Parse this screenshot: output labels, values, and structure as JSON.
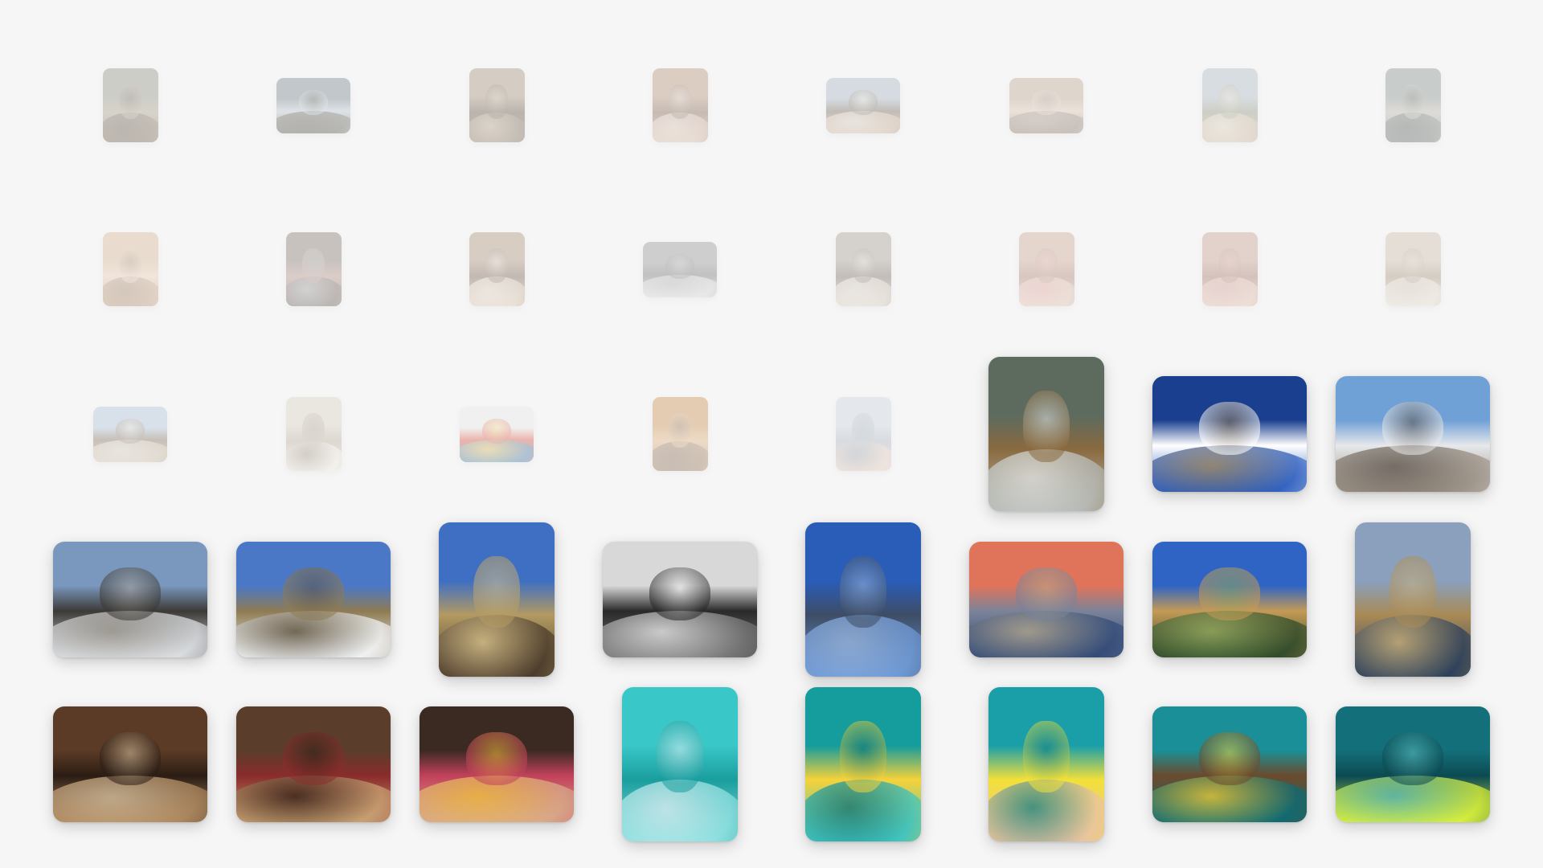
{
  "app": {
    "background": "#f6f6f6"
  },
  "rows": [
    {
      "name": "row-1",
      "faded": true,
      "items": [
        {
          "id": "chicken-coop",
          "orientation": "portrait",
          "palette": [
            "#8c8b7e",
            "#6b5a45",
            "#a79c86",
            "#4f4437"
          ]
        },
        {
          "id": "man-under-tree",
          "orientation": "landscape",
          "palette": [
            "#6e7d86",
            "#4d4a3f",
            "#b7c5d0",
            "#3b3529"
          ]
        },
        {
          "id": "dog-doorway",
          "orientation": "portrait",
          "palette": [
            "#a08c74",
            "#7a6650",
            "#5a4b3c",
            "#c9b59a"
          ]
        },
        {
          "id": "hands-eggs",
          "orientation": "portrait",
          "palette": [
            "#b08b70",
            "#d0b09a",
            "#7a5c49",
            "#e6d2c2"
          ]
        },
        {
          "id": "girls-on-fence",
          "orientation": "landscape",
          "palette": [
            "#a0b0bd",
            "#c7a98c",
            "#6f6054",
            "#e6e0d8"
          ]
        },
        {
          "id": "two-girls-selfie",
          "orientation": "landscape",
          "palette": [
            "#b9a18a",
            "#7d6a5d",
            "#d9c3ad",
            "#9a8776"
          ]
        },
        {
          "id": "girl-scarf",
          "orientation": "portrait",
          "palette": [
            "#a8b7c2",
            "#c9b195",
            "#8b8f77",
            "#e9dccb"
          ]
        },
        {
          "id": "eggs-in-hand",
          "orientation": "portrait",
          "palette": [
            "#7f8a86",
            "#5d6560",
            "#b8b2a8",
            "#3f4643"
          ]
        }
      ]
    },
    {
      "name": "row-2",
      "faded": true,
      "items": [
        {
          "id": "girl-wicker-chair",
          "orientation": "portrait",
          "palette": [
            "#d5b48f",
            "#b88e6a",
            "#e9c9b3",
            "#8a6a4f"
          ]
        },
        {
          "id": "girl-on-floor",
          "orientation": "portrait",
          "palette": [
            "#7f6f66",
            "#5b4c45",
            "#b08d80",
            "#9aa4a8"
          ]
        },
        {
          "id": "woman-with-cat",
          "orientation": "portrait",
          "palette": [
            "#a98c72",
            "#d6c1a8",
            "#6e5846",
            "#f0e2d2"
          ]
        },
        {
          "id": "two-women-doorway",
          "orientation": "landscape",
          "palette": [
            "#8f8f8f",
            "#d6d6d6",
            "#6b6b6b",
            "#b6b6b6"
          ]
        },
        {
          "id": "girl-holding-cat",
          "orientation": "portrait",
          "palette": [
            "#a1978c",
            "#d6c8b8",
            "#6f6259",
            "#e8ddd1"
          ]
        },
        {
          "id": "girl-pink-sweater",
          "orientation": "portrait",
          "palette": [
            "#c9a28b",
            "#e0c0aa",
            "#a87c6b",
            "#e8a2a0"
          ]
        },
        {
          "id": "girl-hand-hair",
          "orientation": "portrait",
          "palette": [
            "#c49a86",
            "#e2bba8",
            "#a16e60",
            "#d89d98"
          ]
        },
        {
          "id": "girl-with-puppy",
          "orientation": "portrait",
          "palette": [
            "#c8b9a4",
            "#e6dccd",
            "#a28d72",
            "#d3c9bb"
          ]
        }
      ]
    },
    {
      "name": "row-3",
      "faded": false,
      "items": [
        {
          "id": "cowboy-on-horse",
          "orientation": "landscape",
          "faded": true,
          "palette": [
            "#a9c0d6",
            "#c9b79f",
            "#7d6a55",
            "#e3dcd2"
          ]
        },
        {
          "id": "girl-with-white-horse",
          "orientation": "portrait",
          "faded": true,
          "palette": [
            "#d9cfbf",
            "#f2ede4",
            "#b5a893",
            "#8c7e6a"
          ]
        },
        {
          "id": "archery-target",
          "orientation": "landscape",
          "faded": true,
          "palette": [
            "#e7e7e7",
            "#2f6fa1",
            "#d94b3a",
            "#f2d24a"
          ]
        },
        {
          "id": "girl-orange-sweater",
          "orientation": "portrait",
          "faded": true,
          "palette": [
            "#c98a45",
            "#8e6a4c",
            "#e1b07a",
            "#6e5646"
          ]
        },
        {
          "id": "sunset-sea",
          "orientation": "portrait",
          "faded": true,
          "palette": [
            "#c8d4de",
            "#e7c9b9",
            "#a7b2bd",
            "#8c98a3"
          ]
        },
        {
          "id": "frost-grass-rock",
          "orientation": "portrait-lg",
          "palette": [
            "#5d6b5f",
            "#b6bab6",
            "#8a6a3f",
            "#e3e6e6"
          ]
        },
        {
          "id": "snowy-peak-blue-sky",
          "orientation": "landscape",
          "palette": [
            "#1a3f8f",
            "#2e5fbf",
            "#ffffff",
            "#8a744f"
          ]
        },
        {
          "id": "snowy-boulders",
          "orientation": "landscape",
          "palette": [
            "#6fa0d6",
            "#9c9286",
            "#e6e8ea",
            "#5a5149"
          ]
        }
      ]
    },
    {
      "name": "row-4",
      "faded": false,
      "items": [
        {
          "id": "snow-rocks-ridge",
          "orientation": "landscape",
          "palette": [
            "#7a97bd",
            "#dcdfe3",
            "#3c3a36",
            "#a7a29a"
          ]
        },
        {
          "id": "mountain-meadow",
          "orientation": "landscape",
          "palette": [
            "#4a78c7",
            "#f1f3f5",
            "#8e7b53",
            "#5c5140"
          ]
        },
        {
          "id": "pine-trunks",
          "orientation": "portrait-lg",
          "palette": [
            "#3e6fc2",
            "#4a3a2a",
            "#b39a62",
            "#d9c48f"
          ]
        },
        {
          "id": "bw-mountain",
          "orientation": "landscape",
          "palette": [
            "#d8d8d8",
            "#777777",
            "#2a2a2a",
            "#f3f3f3"
          ]
        },
        {
          "id": "horse-in-water",
          "orientation": "portrait-lg",
          "palette": [
            "#2a5db8",
            "#6f9ad6",
            "#3d4d66",
            "#9bb7de"
          ]
        },
        {
          "id": "sunset-forest",
          "orientation": "landscape",
          "palette": [
            "#e0745a",
            "#334b78",
            "#7a8399",
            "#b6a98c"
          ]
        },
        {
          "id": "pine-valley",
          "orientation": "landscape",
          "palette": [
            "#2f64c4",
            "#2f4a2a",
            "#c49a55",
            "#8aa85f"
          ]
        },
        {
          "id": "grassland-horizon",
          "orientation": "portrait-lg",
          "palette": [
            "#8aa0bd",
            "#2b3f5a",
            "#a98a55",
            "#c9b27e"
          ]
        }
      ]
    },
    {
      "name": "row-5",
      "faded": false,
      "items": [
        {
          "id": "pug-on-deck",
          "orientation": "landscape",
          "palette": [
            "#5b3b25",
            "#b08a60",
            "#2b1d14",
            "#d8c3a3"
          ]
        },
        {
          "id": "pug-sleeping",
          "orientation": "landscape",
          "palette": [
            "#5a3d2b",
            "#c9a173",
            "#8a2c2c",
            "#2d1e14"
          ]
        },
        {
          "id": "mother-daughter",
          "orientation": "landscape",
          "palette": [
            "#3b2a22",
            "#d9a98a",
            "#c2425b",
            "#f0c23a"
          ]
        },
        {
          "id": "girl-in-pool-swimsuit",
          "orientation": "portrait-lg",
          "palette": [
            "#39c7c7",
            "#8fe0e0",
            "#1a9e9e",
            "#e1eef2"
          ]
        },
        {
          "id": "girls-underwater",
          "orientation": "portrait-lg",
          "palette": [
            "#159c9c",
            "#3fc3c0",
            "#f5d23a",
            "#0f6f6f"
          ]
        },
        {
          "id": "girl-smiling-pool",
          "orientation": "portrait-lg",
          "palette": [
            "#1a9fa8",
            "#e9c49f",
            "#f2e03a",
            "#0f7c85"
          ]
        },
        {
          "id": "hair-underwater",
          "orientation": "landscape",
          "palette": [
            "#1a8f97",
            "#0e6a72",
            "#6b4a2d",
            "#f0d23a"
          ]
        },
        {
          "id": "yellow-shirt-water",
          "orientation": "landscape",
          "palette": [
            "#136f7a",
            "#d9ef3a",
            "#0c4a52",
            "#5fbfbd"
          ]
        }
      ]
    }
  ]
}
